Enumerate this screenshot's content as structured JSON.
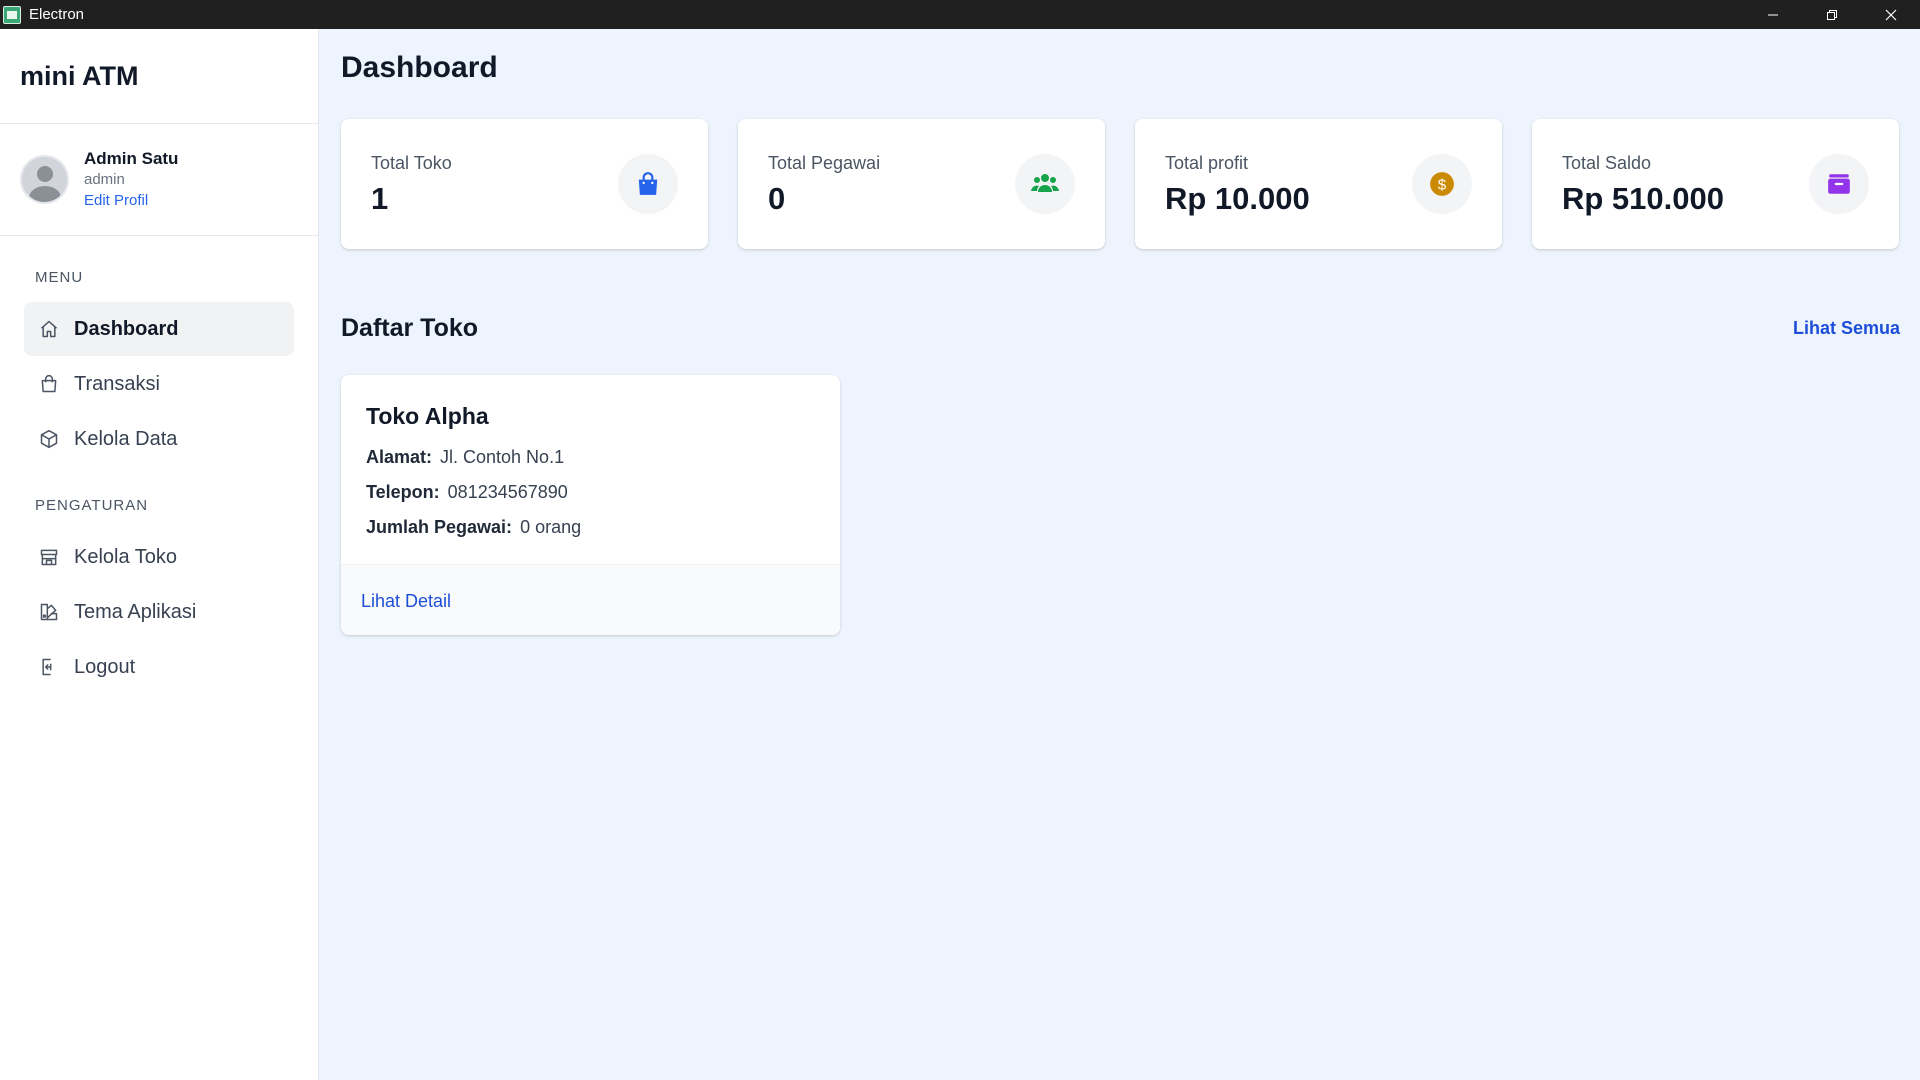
{
  "window": {
    "title": "Electron"
  },
  "sidebar": {
    "brand": "mini ATM",
    "profile": {
      "name": "Admin Satu",
      "role": "admin",
      "edit_label": "Edit Profil"
    },
    "menu_label": "MENU",
    "menu_items": [
      {
        "label": "Dashboard",
        "icon": "home-icon",
        "active": true
      },
      {
        "label": "Transaksi",
        "icon": "shopping-bag-icon",
        "active": false
      },
      {
        "label": "Kelola Data",
        "icon": "cube-icon",
        "active": false
      }
    ],
    "settings_label": "PENGATURAN",
    "settings_items": [
      {
        "label": "Kelola Toko",
        "icon": "store-icon"
      },
      {
        "label": "Tema Aplikasi",
        "icon": "palette-icon"
      },
      {
        "label": "Logout",
        "icon": "logout-icon"
      }
    ]
  },
  "main": {
    "title": "Dashboard",
    "stats": [
      {
        "label": "Total Toko",
        "value": "1",
        "icon": "shopping-bag-icon",
        "color": "#2563eb"
      },
      {
        "label": "Total Pegawai",
        "value": "0",
        "icon": "users-icon",
        "color": "#16a34a"
      },
      {
        "label": "Total profit",
        "value": "Rp 10.000",
        "icon": "dollar-coin-icon",
        "color": "#ca8a04"
      },
      {
        "label": "Total Saldo",
        "value": "Rp 510.000",
        "icon": "wallet-icon",
        "color": "#9333ea"
      }
    ],
    "store_section": {
      "title": "Daftar Toko",
      "see_all_label": "Lihat Semua",
      "stores": [
        {
          "name": "Toko Alpha",
          "address_label": "Alamat:",
          "address": "Jl. Contoh No.1",
          "phone_label": "Telepon:",
          "phone": "081234567890",
          "employees_label": "Jumlah Pegawai:",
          "employees": "0 orang",
          "detail_label": "Lihat Detail"
        }
      ]
    }
  },
  "colors": {
    "accent": "#1d4ed8",
    "background": "#eef4fd",
    "titlebar": "#202020"
  }
}
